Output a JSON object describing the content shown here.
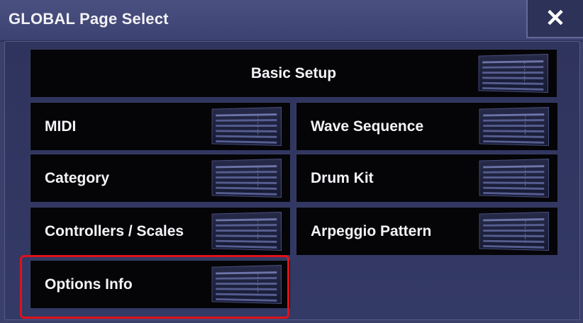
{
  "dialog": {
    "title": "GLOBAL Page Select",
    "close_label": "✕"
  },
  "tiles": {
    "basic_setup": "Basic Setup",
    "midi": "MIDI",
    "wave_sequence": "Wave Sequence",
    "category": "Category",
    "drum_kit": "Drum Kit",
    "controllers_scales": "Controllers / Scales",
    "arpeggio_pattern": "Arpeggio Pattern",
    "options_info": "Options Info"
  },
  "colors": {
    "highlight": "#e0111b",
    "tile_bg": "#050508",
    "dialog_bg": "#3a406a"
  }
}
